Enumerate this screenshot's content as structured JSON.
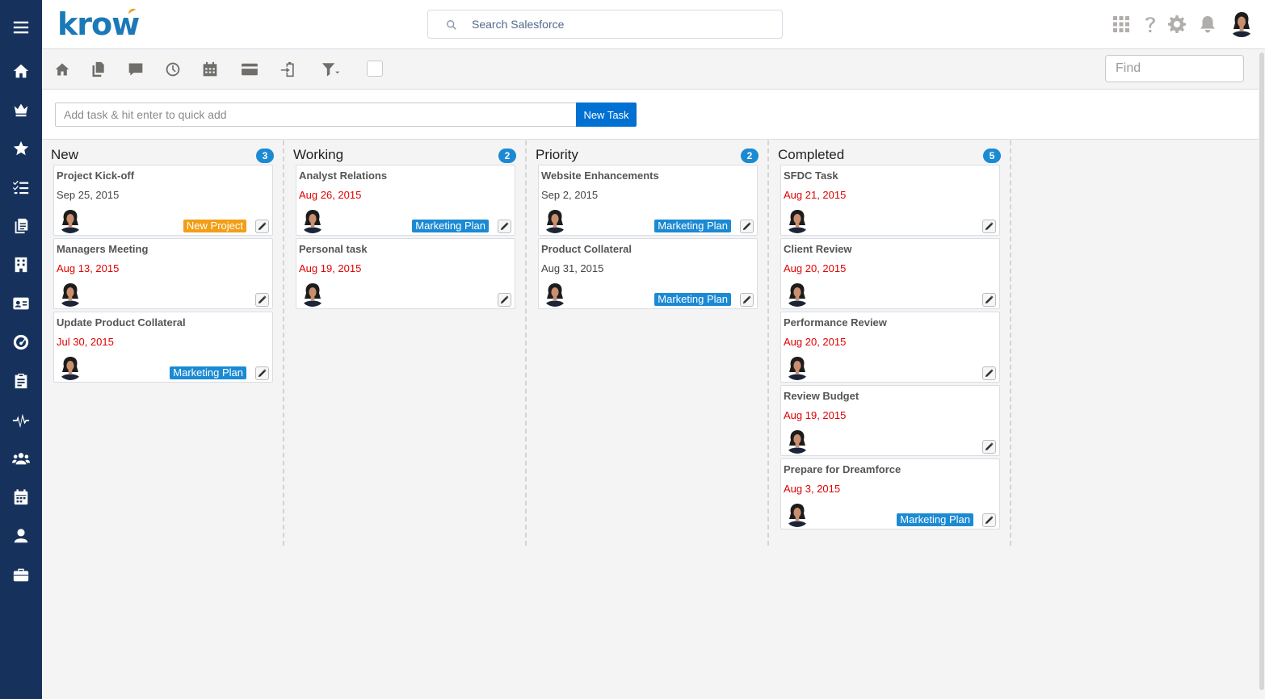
{
  "app": {
    "logo_text": "krow"
  },
  "header": {
    "search_placeholder": "Search Salesforce"
  },
  "toolbar": {
    "find_placeholder": "Find"
  },
  "quick_add": {
    "placeholder": "Add task & hit enter to quick add",
    "button_label": "New Task"
  },
  "colors": {
    "sidebar": "#16325c",
    "accent": "#0070d2",
    "count_badge": "#1b8ad3",
    "tag_orange": "#f29e16",
    "tag_blue": "#1b8ad3",
    "overdue": "#e00000"
  },
  "sidebar_icons": [
    "menu-icon",
    "home-icon",
    "crown-icon",
    "star-icon",
    "tasks-icon",
    "documents-icon",
    "building-icon",
    "contact-card-icon",
    "dashboard-icon",
    "clipboard-icon",
    "pulse-icon",
    "groups-icon",
    "calendar-icon",
    "user-icon",
    "briefcase-icon"
  ],
  "columns": [
    {
      "title": "New",
      "count": "3",
      "cards": [
        {
          "title": "Project Kick-off",
          "date": "Sep 25, 2015",
          "overdue": false,
          "tag": "New Project",
          "tag_color": "orange"
        },
        {
          "title": "Managers Meeting",
          "date": "Aug 13, 2015",
          "overdue": true,
          "tag": "",
          "tag_color": ""
        },
        {
          "title": "Update Product Collateral",
          "date": "Jul 30, 2015",
          "overdue": true,
          "tag": "Marketing Plan",
          "tag_color": "blue"
        }
      ]
    },
    {
      "title": "Working",
      "count": "2",
      "cards": [
        {
          "title": "Analyst Relations",
          "date": "Aug 26, 2015",
          "overdue": true,
          "tag": "Marketing Plan",
          "tag_color": "blue"
        },
        {
          "title": "Personal task",
          "date": "Aug 19, 2015",
          "overdue": true,
          "tag": "",
          "tag_color": ""
        }
      ]
    },
    {
      "title": "Priority",
      "count": "2",
      "cards": [
        {
          "title": "Website Enhancements",
          "date": "Sep 2, 2015",
          "overdue": false,
          "tag": "Marketing Plan",
          "tag_color": "blue"
        },
        {
          "title": "Product Collateral",
          "date": "Aug 31, 2015",
          "overdue": false,
          "tag": "Marketing Plan",
          "tag_color": "blue"
        }
      ]
    },
    {
      "title": "Completed",
      "count": "5",
      "cards": [
        {
          "title": "SFDC Task",
          "date": "Aug 21, 2015",
          "overdue": true,
          "tag": "",
          "tag_color": ""
        },
        {
          "title": "Client Review",
          "date": "Aug 20, 2015",
          "overdue": true,
          "tag": "",
          "tag_color": ""
        },
        {
          "title": "Performance Review",
          "date": "Aug 20, 2015",
          "overdue": true,
          "tag": "",
          "tag_color": ""
        },
        {
          "title": "Review Budget",
          "date": "Aug 19, 2015",
          "overdue": true,
          "tag": "",
          "tag_color": ""
        },
        {
          "title": "Prepare for Dreamforce",
          "date": "Aug 3, 2015",
          "overdue": true,
          "tag": "Marketing Plan",
          "tag_color": "blue"
        }
      ]
    }
  ]
}
